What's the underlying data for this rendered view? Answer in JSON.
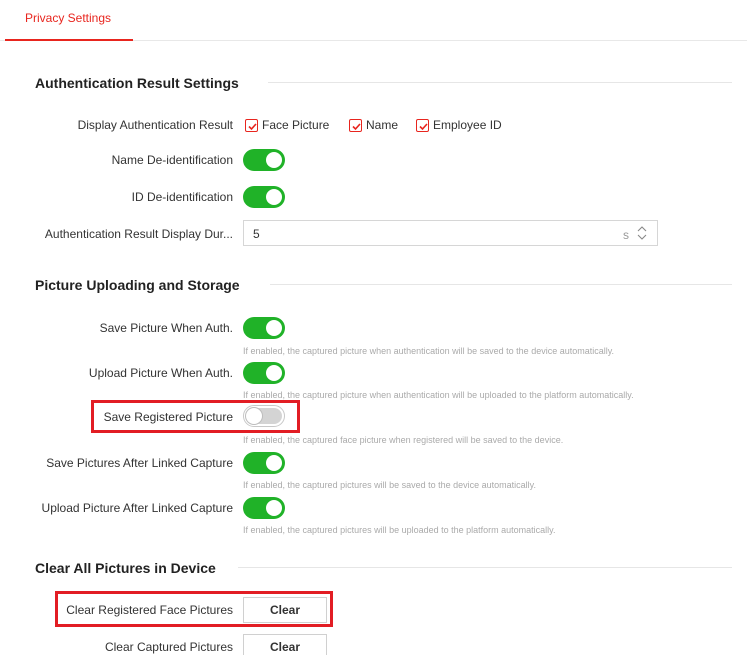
{
  "tabs": {
    "active": "Privacy Settings"
  },
  "auth": {
    "title": "Authentication Result Settings",
    "display_label": "Display Authentication Result",
    "options": [
      {
        "label": "Face Picture",
        "checked": true
      },
      {
        "label": "Name",
        "checked": true
      },
      {
        "label": "Employee ID",
        "checked": true
      }
    ],
    "name_deid_label": "Name De-identification",
    "name_deid_on": true,
    "id_deid_label": "ID De-identification",
    "id_deid_on": true,
    "duration_label": "Authentication Result Display Dur...",
    "duration_value": "5",
    "duration_unit": "s"
  },
  "upload": {
    "title": "Picture Uploading and Storage",
    "items": [
      {
        "label": "Save Picture When Auth.",
        "on": true,
        "hint": "If enabled, the captured picture when authentication will be saved to the device automatically."
      },
      {
        "label": "Upload Picture When Auth.",
        "on": true,
        "hint": "If enabled, the captured picture when authentication will be uploaded to the platform automatically."
      },
      {
        "label": "Save Registered Picture",
        "on": false,
        "hint": "If enabled, the captured face picture when registered will be saved to the device."
      },
      {
        "label": "Save Pictures After Linked Capture",
        "on": true,
        "hint": "If enabled, the captured pictures will be saved to the device automatically."
      },
      {
        "label": "Upload Picture After Linked Capture",
        "on": true,
        "hint": "If enabled, the captured pictures will be uploaded to the platform automatically."
      }
    ]
  },
  "clear": {
    "title": "Clear All Pictures in Device",
    "registered_label": "Clear Registered Face Pictures",
    "captured_label": "Clear Captured Pictures",
    "button_label": "Clear"
  },
  "colors": {
    "accent": "#e8251e",
    "toggle_on": "#20b228",
    "highlight": "#e21d24"
  }
}
